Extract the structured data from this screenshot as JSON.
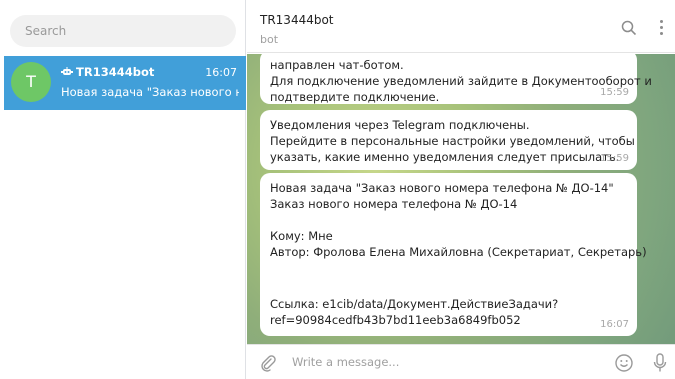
{
  "sidebar": {
    "search_placeholder": "Search",
    "chats": [
      {
        "avatar_letter": "T",
        "avatar_color": "#6ec766",
        "name": "TR13444bot",
        "time": "16:07",
        "preview": "Новая задача \"Заказ нового н...",
        "icon": "bot-icon"
      }
    ]
  },
  "header": {
    "title": "TR13444bot",
    "subtitle": "bot",
    "icons": [
      "search-icon",
      "more-vertical-icon"
    ]
  },
  "messages": [
    {
      "lines": [
        "направлен чат-ботом.",
        "Для подключение уведомлений зайдите в Документооборот и",
        "подтвердите подключение."
      ],
      "time": "15:59"
    },
    {
      "lines": [
        "Уведомления через Telegram подключены.",
        "Перейдите в персональные настройки уведомлений, чтобы",
        "указать, какие именно уведомления следует присылать."
      ],
      "time": "15:59"
    },
    {
      "lines": [
        "Новая задача \"Заказ нового номера телефона № ДО-14\"",
        "Заказ нового номера телефона № ДО-14",
        "Кому: Мне",
        "Автор: Фролова Елена Михайловна (Секретариат, Секретарь)",
        "Ссылка: e1cib/data/Документ.ДействиеЗадачи?",
        "ref=90984cedfb43b7bd11eeb3a6849fb052"
      ],
      "time": "16:07"
    }
  ],
  "composer": {
    "placeholder": "Write a message...",
    "icons": [
      "paperclip-icon",
      "emoji-icon",
      "microphone-icon"
    ]
  },
  "colors": {
    "accent": "#419fd9",
    "avatar": "#6ec766"
  }
}
